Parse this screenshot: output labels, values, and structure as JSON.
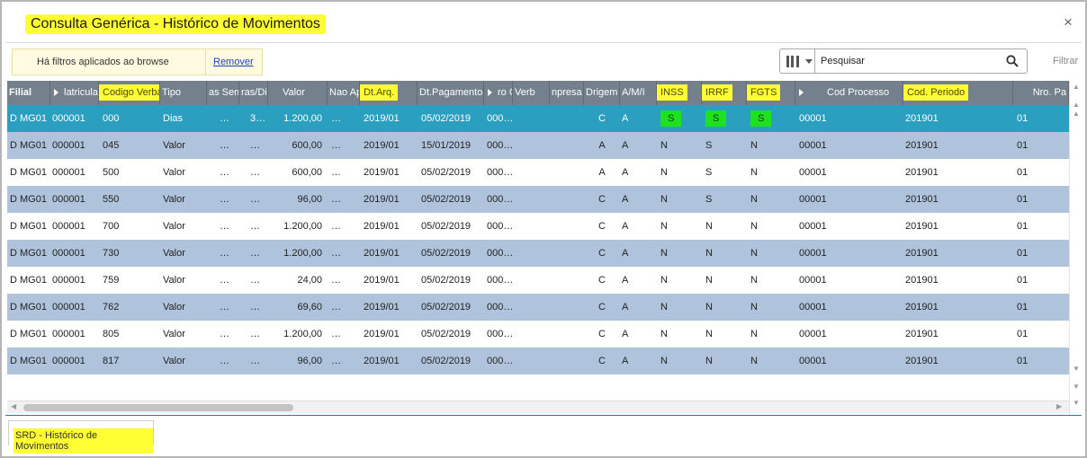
{
  "window": {
    "title": "Consulta Genérica - Histórico de Movimentos",
    "close_icon": "×"
  },
  "toolbar": {
    "filter_notice": "Há filtros aplicados ao browse",
    "remove_label": "Remover",
    "search_placeholder": "Pesquisar",
    "filter_label": "Filtrar",
    "columns_icon": "columns-icon"
  },
  "grid": {
    "columns": [
      {
        "label": "Filial",
        "bold": true
      },
      {
        "label": "latricula",
        "arrow": true
      },
      {
        "label": "Codigo Verba",
        "highlight": true
      },
      {
        "label": "Tipo"
      },
      {
        "label": "as Sem"
      },
      {
        "label": "ras/Dia"
      },
      {
        "label": "Valor"
      },
      {
        "label": "Nao Ap"
      },
      {
        "label": "Dt.Arq.",
        "highlight": true
      },
      {
        "label": "Dt.Pagamento"
      },
      {
        "label": "ro Cq.",
        "arrow": true
      },
      {
        "label": "Verb"
      },
      {
        "label": "npresa"
      },
      {
        "label": "Drigem"
      },
      {
        "label": "A/M/I"
      },
      {
        "label": "INSS",
        "highlight": true
      },
      {
        "label": "IRRF",
        "highlight": true
      },
      {
        "label": "FGTS",
        "highlight": true
      },
      {
        "label": "Cod Processo",
        "arrow": true
      },
      {
        "label": "Cod. Periodo",
        "highlight": true
      },
      {
        "label": "Nro. Pa"
      }
    ],
    "rows": [
      [
        "D MG01",
        "000001",
        "000",
        "Dias",
        "…",
        "3…",
        "1.200,00",
        "…",
        "2019/01",
        "05/02/2019",
        "000…",
        "",
        "",
        "C",
        "A",
        "S",
        "S",
        "S",
        "00001",
        "201901",
        "01"
      ],
      [
        "D MG01",
        "000001",
        "045",
        "Valor",
        "…",
        "…",
        "600,00",
        "…",
        "2019/01",
        "15/01/2019",
        "000…",
        "",
        "",
        "A",
        "A",
        "N",
        "S",
        "N",
        "00001",
        "201901",
        "01"
      ],
      [
        "D MG01",
        "000001",
        "500",
        "Valor",
        "…",
        "…",
        "600,00",
        "…",
        "2019/01",
        "05/02/2019",
        "000…",
        "",
        "",
        "A",
        "A",
        "N",
        "S",
        "N",
        "00001",
        "201901",
        "01"
      ],
      [
        "D MG01",
        "000001",
        "550",
        "Valor",
        "…",
        "…",
        "96,00",
        "…",
        "2019/01",
        "05/02/2019",
        "000…",
        "",
        "",
        "C",
        "A",
        "N",
        "S",
        "N",
        "00001",
        "201901",
        "01"
      ],
      [
        "D MG01",
        "000001",
        "700",
        "Valor",
        "…",
        "…",
        "1.200,00",
        "…",
        "2019/01",
        "05/02/2019",
        "000…",
        "",
        "",
        "C",
        "A",
        "N",
        "N",
        "N",
        "00001",
        "201901",
        "01"
      ],
      [
        "D MG01",
        "000001",
        "730",
        "Valor",
        "…",
        "…",
        "1.200,00",
        "…",
        "2019/01",
        "05/02/2019",
        "000…",
        "",
        "",
        "C",
        "A",
        "N",
        "N",
        "N",
        "00001",
        "201901",
        "01"
      ],
      [
        "D MG01",
        "000001",
        "759",
        "Valor",
        "…",
        "…",
        "24,00",
        "…",
        "2019/01",
        "05/02/2019",
        "000…",
        "",
        "",
        "C",
        "A",
        "N",
        "N",
        "N",
        "00001",
        "201901",
        "01"
      ],
      [
        "D MG01",
        "000001",
        "762",
        "Valor",
        "…",
        "…",
        "69,60",
        "…",
        "2019/01",
        "05/02/2019",
        "000…",
        "",
        "",
        "C",
        "A",
        "N",
        "N",
        "N",
        "00001",
        "201901",
        "01"
      ],
      [
        "D MG01",
        "000001",
        "805",
        "Valor",
        "…",
        "…",
        "1.200,00",
        "…",
        "2019/01",
        "05/02/2019",
        "000…",
        "",
        "",
        "C",
        "A",
        "N",
        "N",
        "N",
        "00001",
        "201901",
        "01"
      ],
      [
        "D MG01",
        "000001",
        "817",
        "Valor",
        "…",
        "…",
        "96,00",
        "…",
        "2019/01",
        "05/02/2019",
        "000…",
        "",
        "",
        "C",
        "A",
        "N",
        "N",
        "N",
        "00001",
        "201901",
        "01"
      ]
    ],
    "selected_row": 0
  },
  "tabs": [
    {
      "label": "SRD - Histórico de Movimentos"
    }
  ],
  "colors": {
    "header_bg": "#74808b",
    "selected_row": "#2a9fbf",
    "alt_row": "#afc4dc",
    "highlight_yellow": "#ffff33",
    "highlight_green": "#1de21d"
  }
}
